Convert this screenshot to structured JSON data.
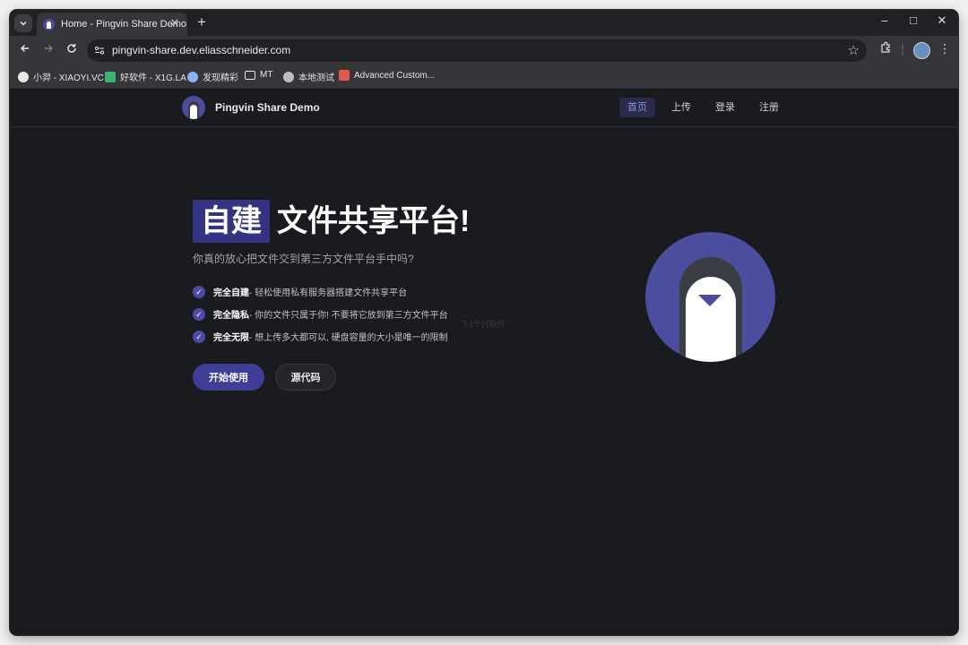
{
  "browser": {
    "tab_title": "Home - Pingvin Share Demo",
    "tab_close": "✕",
    "new_tab": "+",
    "url": "pingvin-share.dev.eliasschneider.com",
    "window_controls": {
      "minimize": "–",
      "maximize": "□",
      "close": "✕"
    },
    "bookmarks": [
      {
        "label": "小羿 - XIAOYI.VC",
        "icon": "person-icon",
        "color": "#e8e8e8"
      },
      {
        "label": "好软件 - X1G.LA",
        "icon": "app-icon",
        "color": "#3cb371"
      },
      {
        "label": "发现精彩",
        "icon": "wordpress-icon",
        "color": "#8ab4f8"
      },
      {
        "label": "MT",
        "icon": "folder-icon",
        "color": "#e3e3e3"
      },
      {
        "label": "本地测试",
        "icon": "globe-icon",
        "color": "#bdbdbd"
      },
      {
        "label": "Advanced Custom...",
        "icon": "acf-icon",
        "color": "#e35656"
      }
    ]
  },
  "site": {
    "title": "Pingvin Share Demo",
    "nav": [
      {
        "label": "首页",
        "active": true
      },
      {
        "label": "上传",
        "active": false
      },
      {
        "label": "登录",
        "active": false
      },
      {
        "label": "注册",
        "active": false
      }
    ]
  },
  "hero": {
    "highlight": "自建",
    "title_rest": "文件共享平台!",
    "subtitle": "你真的放心把文件交到第三方文件平台手中吗?",
    "features": [
      {
        "strong": "完全自建",
        "text": " - 轻松使用私有服务器搭建文件共享平台"
      },
      {
        "strong": "完全隐私",
        "text": " - 你的文件只属于你! 不要将它放到第三方文件平台"
      },
      {
        "strong": "完全无限",
        "text": " - 想上传多大都可以, 硬盘容量的大小是唯一的限制"
      }
    ],
    "watermark": "下1个好软件",
    "primary_button": "开始使用",
    "secondary_button": "源代码"
  },
  "colors": {
    "accent": "#4b4e9e",
    "highlight_bg": "#343482",
    "page_bg": "#1a1b1e"
  }
}
